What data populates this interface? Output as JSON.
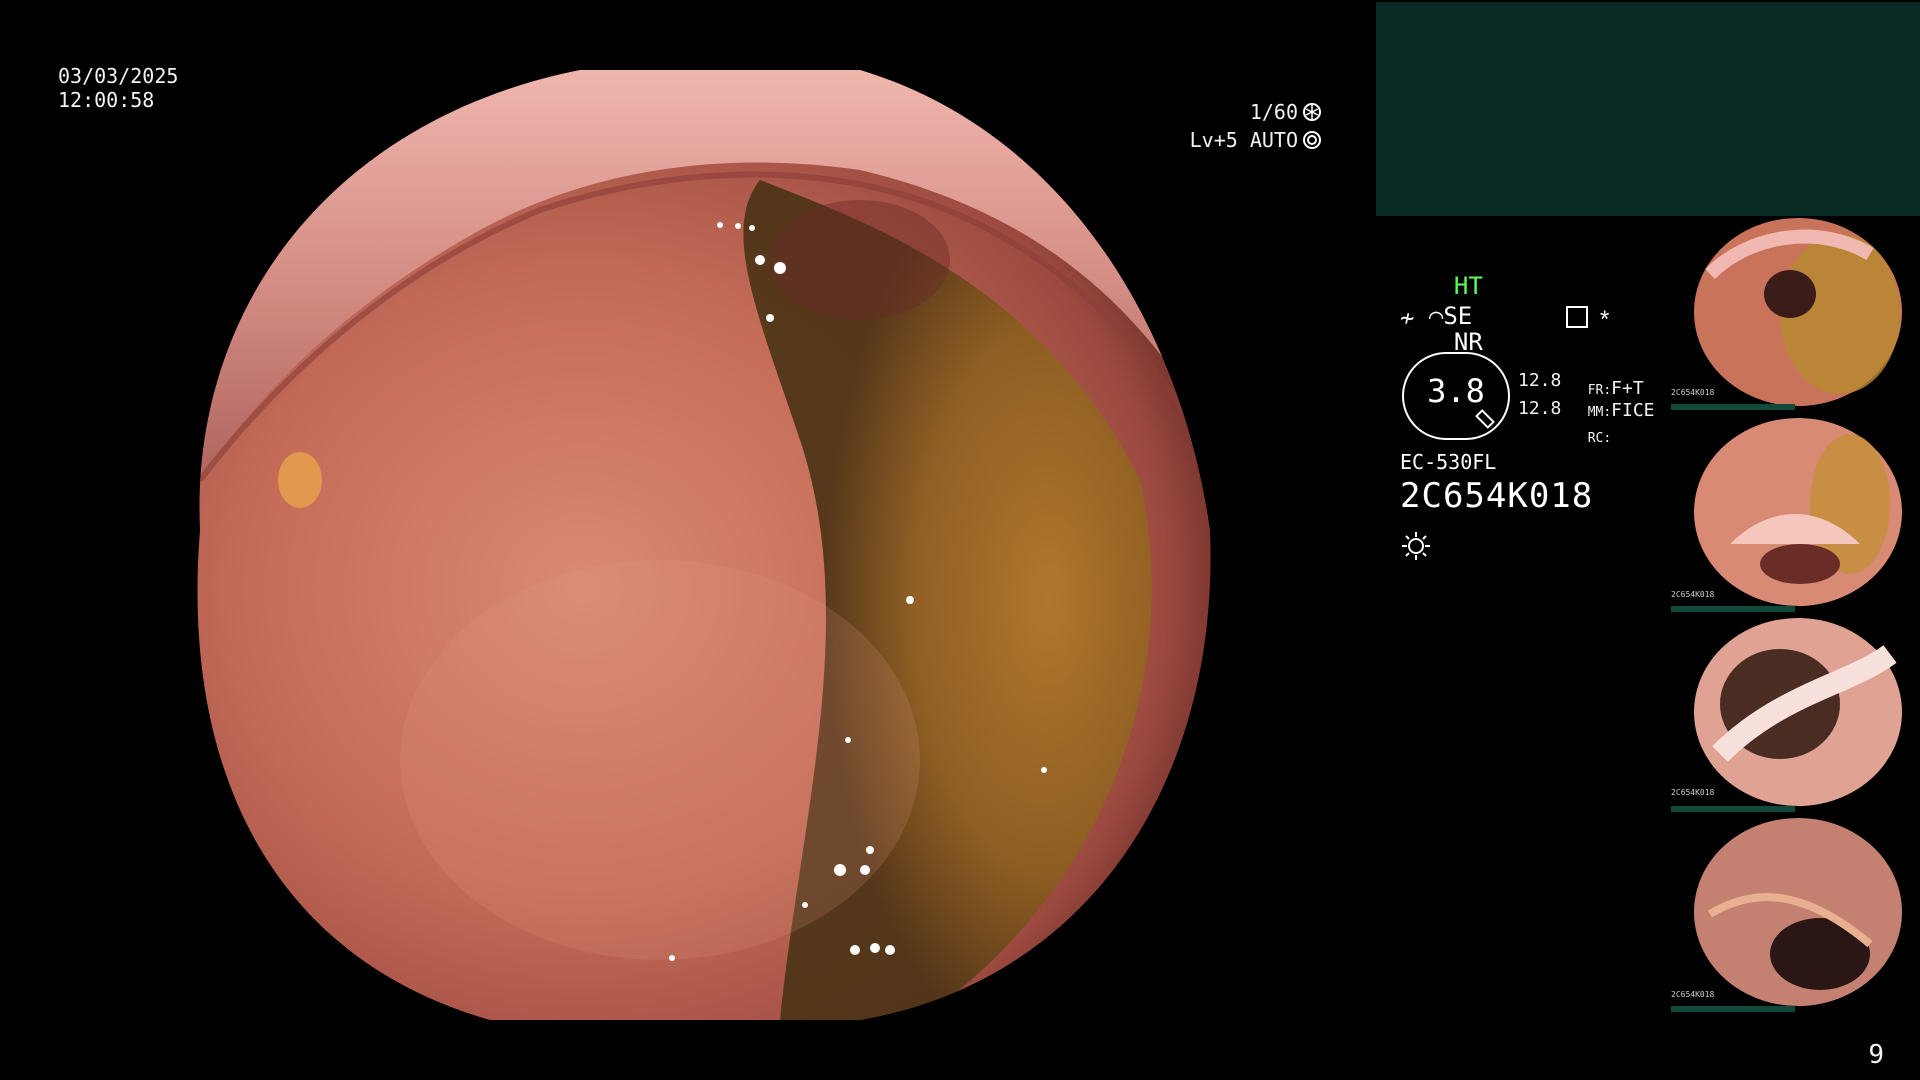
{
  "overlay": {
    "date": "03/03/2025",
    "time": "12:00:58",
    "shutter": "1/60",
    "iris": "Lv+5 AUTO"
  },
  "panel": {
    "ht": "HT",
    "nr": "NR",
    "se": "SE",
    "zoom": "3.8",
    "value_1": "12.8",
    "value_2": "12.8",
    "fr_label": "FR:",
    "fr_value": "F+T",
    "mm_label": "MM:",
    "mm_value": "FICE",
    "rc_label": "RC:",
    "scope_model": "EC-530FL",
    "serial": "2C654K018",
    "asterisk": "*"
  },
  "thumbnails": [
    {
      "label": "2C654K018"
    },
    {
      "label": "2C654K018"
    },
    {
      "label": "2C654K018"
    },
    {
      "label": "2C654K018"
    }
  ],
  "page_number": "9"
}
